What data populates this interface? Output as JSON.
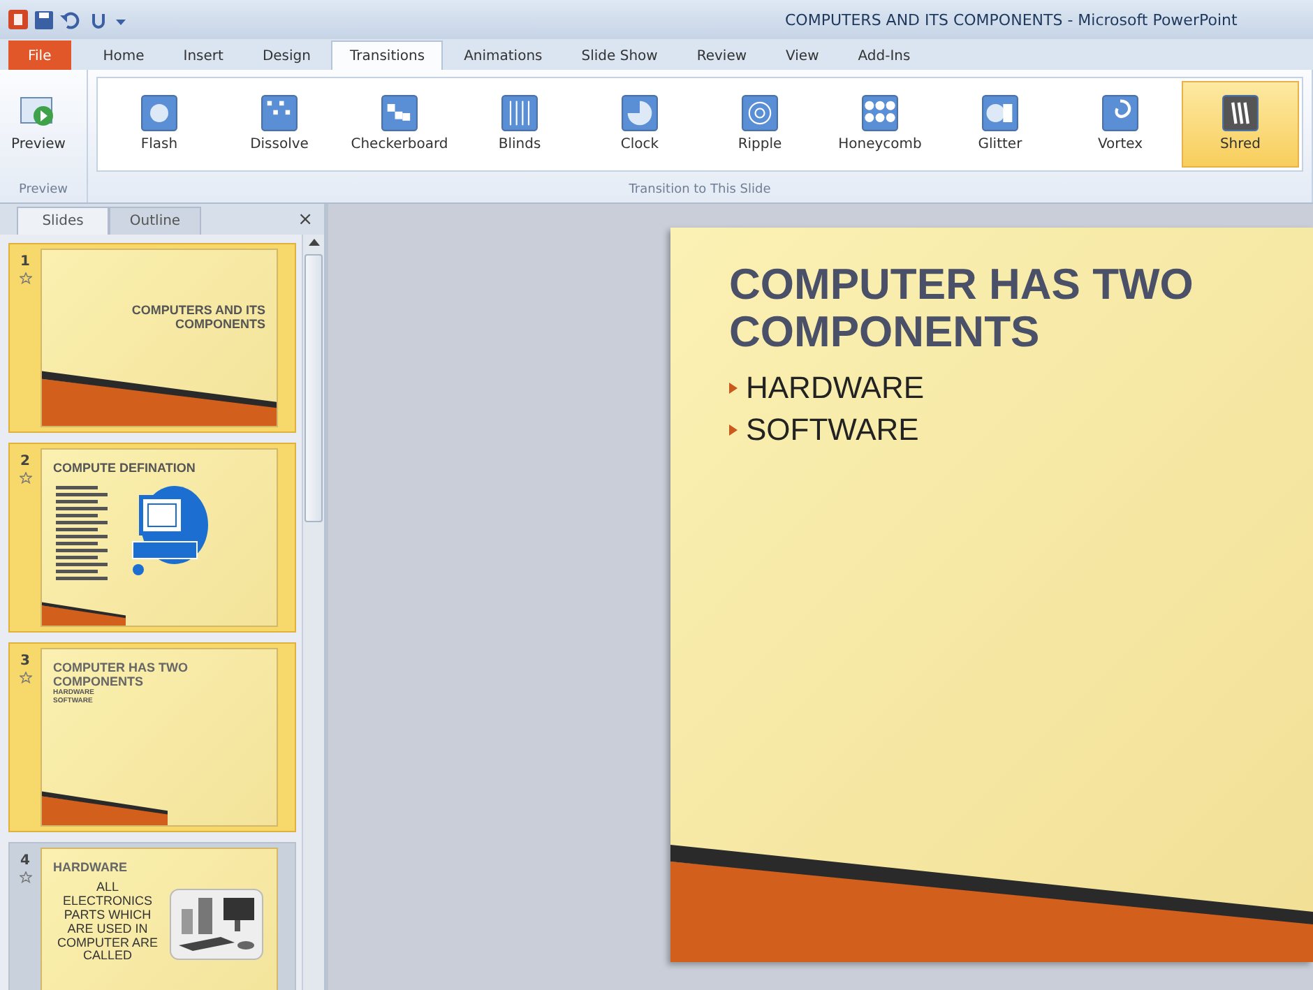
{
  "window": {
    "title": "COMPUTERS AND ITS COMPONENTS - Microsoft PowerPoint"
  },
  "ribbon_tabs": [
    {
      "label": "File",
      "kind": "file",
      "selected": false
    },
    {
      "label": "Home",
      "kind": "tab",
      "selected": false
    },
    {
      "label": "Insert",
      "kind": "tab",
      "selected": false
    },
    {
      "label": "Design",
      "kind": "tab",
      "selected": false
    },
    {
      "label": "Transitions",
      "kind": "tab",
      "selected": true
    },
    {
      "label": "Animations",
      "kind": "tab",
      "selected": false
    },
    {
      "label": "Slide Show",
      "kind": "tab",
      "selected": false
    },
    {
      "label": "Review",
      "kind": "tab",
      "selected": false
    },
    {
      "label": "View",
      "kind": "tab",
      "selected": false
    },
    {
      "label": "Add-Ins",
      "kind": "tab",
      "selected": false
    }
  ],
  "preview_group": {
    "button": "Preview",
    "label": "Preview"
  },
  "transitions_group": {
    "label": "Transition to This Slide",
    "items": [
      {
        "label": "Flash",
        "selected": false
      },
      {
        "label": "Dissolve",
        "selected": false
      },
      {
        "label": "Checkerboard",
        "selected": false
      },
      {
        "label": "Blinds",
        "selected": false
      },
      {
        "label": "Clock",
        "selected": false
      },
      {
        "label": "Ripple",
        "selected": false
      },
      {
        "label": "Honeycomb",
        "selected": false
      },
      {
        "label": "Glitter",
        "selected": false
      },
      {
        "label": "Vortex",
        "selected": false
      },
      {
        "label": "Shred",
        "selected": true
      }
    ]
  },
  "slides_pane": {
    "tabs": [
      {
        "label": "Slides",
        "selected": true
      },
      {
        "label": "Outline",
        "selected": false
      }
    ],
    "close": "×",
    "slides": [
      {
        "number": "1",
        "selected": true,
        "kind": "title",
        "title": "COMPUTERS AND ITS COMPONENTS"
      },
      {
        "number": "2",
        "selected": true,
        "kind": "clipart",
        "title": "COMPUTE  DEFINATION"
      },
      {
        "number": "3",
        "selected": true,
        "kind": "bullets",
        "title": "COMPUTER HAS TWO COMPONENTS",
        "bullets": [
          "HARDWARE",
          "SOFTWARE"
        ]
      },
      {
        "number": "4",
        "selected": false,
        "kind": "picture",
        "title": "HARDWARE",
        "body": "ALL ELECTRONICS PARTS WHICH ARE USED IN COMPUTER ARE CALLED"
      }
    ]
  },
  "current_slide": {
    "title": "COMPUTER HAS TWO COMPONENTS",
    "bullets": [
      "HARDWARE",
      "SOFTWARE"
    ]
  }
}
